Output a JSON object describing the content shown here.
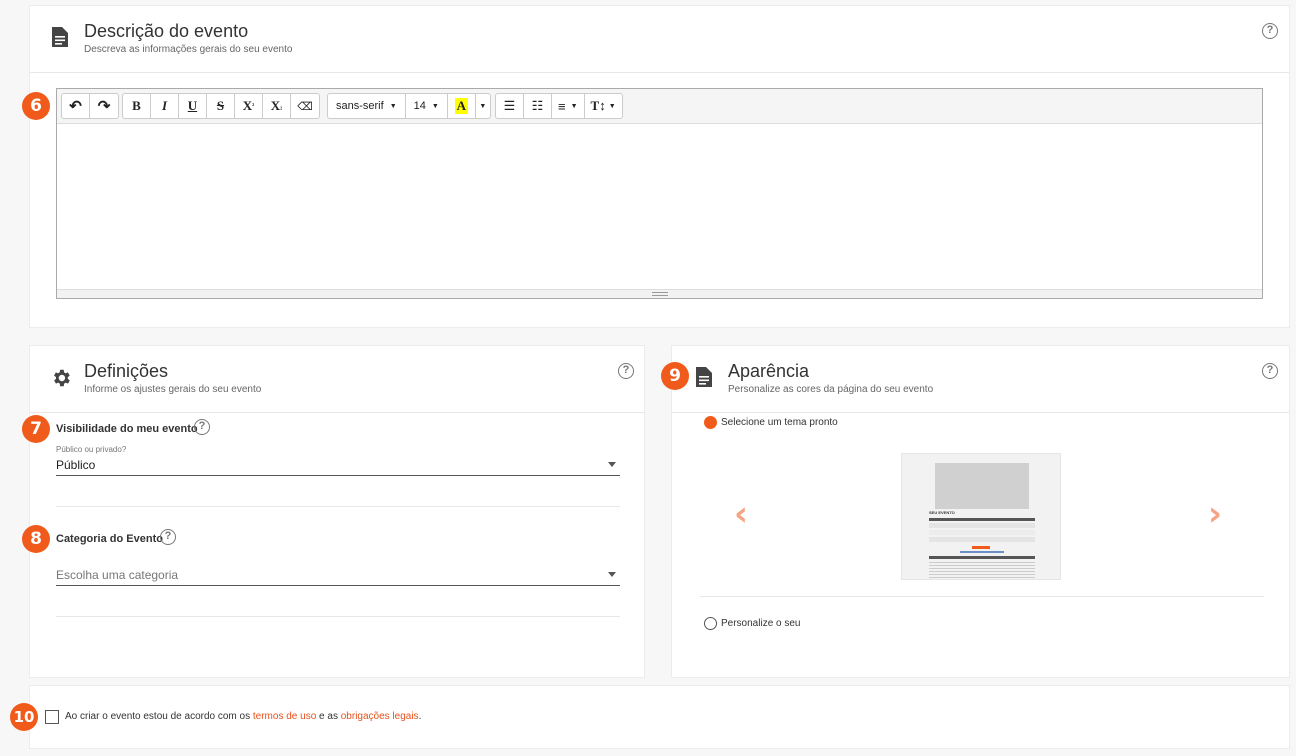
{
  "description": {
    "title": "Descrição do evento",
    "subtitle": "Descreva as informações gerais do seu evento",
    "help": "?",
    "step": "6"
  },
  "toolbar": {
    "undo": "↶",
    "redo": "↷",
    "bold": "B",
    "italic": "I",
    "underline": "U",
    "strike": "S",
    "superscript": "X",
    "superscript_mark": "²",
    "subscript": "X",
    "subscript_mark": "₂",
    "eraser": "⌫",
    "font_family": "sans-serif",
    "font_size": "14",
    "color_letter": "A",
    "bullets": "☰",
    "numbers": "☷",
    "align": "≡",
    "text_height": "T↕"
  },
  "settings": {
    "title": "Definições",
    "subtitle": "Informe os ajustes gerais do seu evento",
    "help": "?",
    "visibility": {
      "step": "7",
      "title": "Visibilidade do meu evento",
      "label": "Público ou privado?",
      "value": "Público"
    },
    "category": {
      "step": "8",
      "title": "Categoria do Evento",
      "placeholder": "Escolha uma categoria"
    }
  },
  "appearance": {
    "step": "9",
    "title": "Aparência",
    "subtitle": "Personalize as cores da página do seu evento",
    "help": "?",
    "option_theme": "Selecione um tema pronto",
    "option_custom": "Personalize o seu",
    "arrow_left": "‹",
    "arrow_right": "›",
    "preview_title": "SEU EVENTO"
  },
  "terms": {
    "step": "10",
    "text_before": "Ao criar o evento estou de acordo com os ",
    "link_terms": "termos de uso",
    "text_middle": " e as ",
    "link_obligations": "obrigações legais",
    "text_after": "."
  },
  "colors": {
    "accent": "#f05a1a",
    "arrow": "#f5a383"
  }
}
